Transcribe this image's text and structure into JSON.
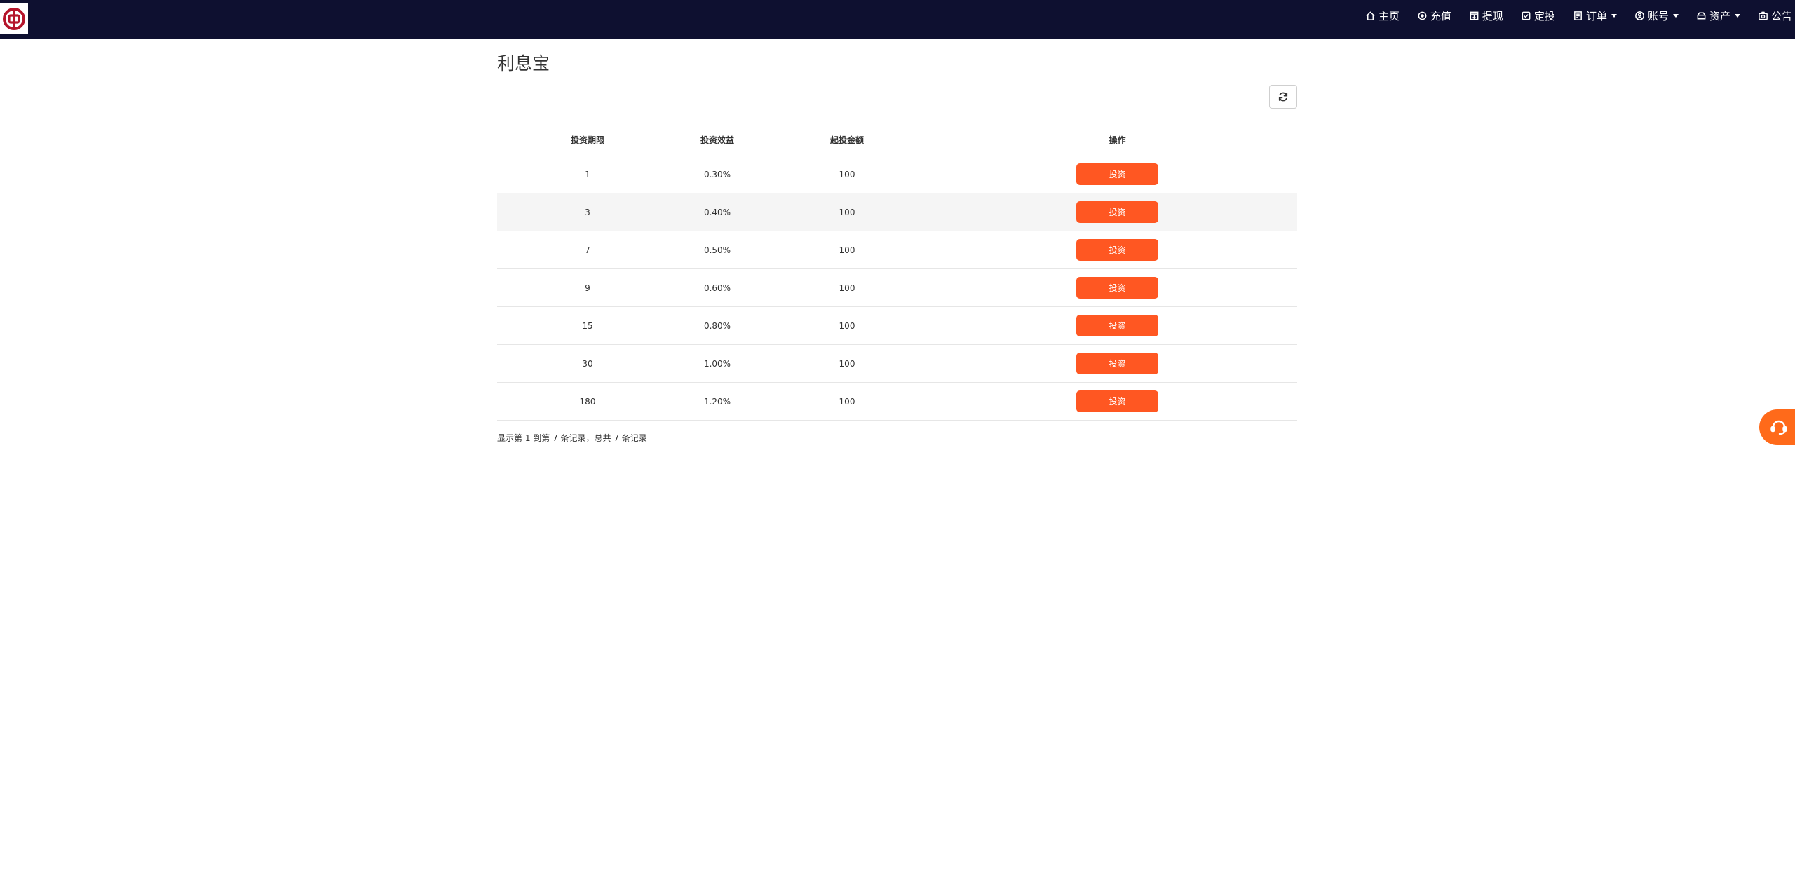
{
  "header": {
    "logo_icon": "bank-of-china-logo",
    "nav": [
      {
        "label": "主页",
        "icon": "home-icon"
      },
      {
        "label": "充值",
        "icon": "recharge-icon"
      },
      {
        "label": "提现",
        "icon": "withdraw-icon"
      },
      {
        "label": "定投",
        "icon": "checkbox-icon"
      },
      {
        "label": "订单",
        "icon": "document-icon"
      },
      {
        "label": "账号",
        "icon": "user-icon"
      },
      {
        "label": "资产",
        "icon": "wallet-icon"
      },
      {
        "label": "公告",
        "icon": "camera-icon"
      }
    ]
  },
  "page": {
    "title": "利息宝",
    "refresh_icon": "refresh-icon"
  },
  "table": {
    "headers": [
      "投资期限",
      "投资效益",
      "起投金额",
      "操作"
    ],
    "rows": [
      {
        "term": "1",
        "rate": "0.30%",
        "min": "100",
        "action": "投资"
      },
      {
        "term": "3",
        "rate": "0.40%",
        "min": "100",
        "action": "投资"
      },
      {
        "term": "7",
        "rate": "0.50%",
        "min": "100",
        "action": "投资"
      },
      {
        "term": "9",
        "rate": "0.60%",
        "min": "100",
        "action": "投资"
      },
      {
        "term": "15",
        "rate": "0.80%",
        "min": "100",
        "action": "投资"
      },
      {
        "term": "30",
        "rate": "1.00%",
        "min": "100",
        "action": "投资"
      },
      {
        "term": "180",
        "rate": "1.20%",
        "min": "100",
        "action": "投资"
      }
    ]
  },
  "pagination": {
    "info": "显示第 1 到第 7 条记录，总共 7 条记录"
  },
  "floating": {
    "service_icon": "customer-service-icon"
  },
  "colors": {
    "navbar": "#0e1030",
    "accent": "#ff5722",
    "service": "#ff6a1a",
    "logo_red": "#b5152b"
  }
}
